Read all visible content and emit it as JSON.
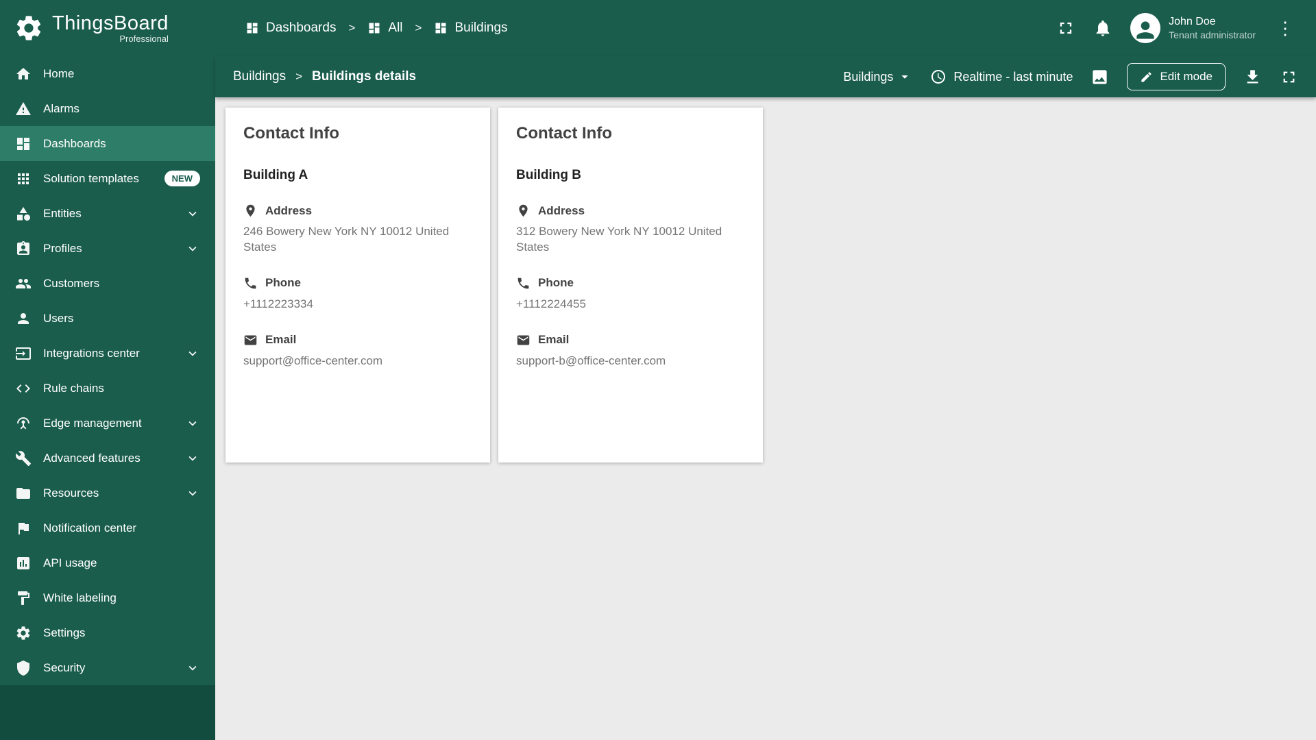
{
  "brand": {
    "name": "ThingsBoard",
    "subtitle": "Professional"
  },
  "topbar": {
    "separator": ">",
    "breadcrumbs": [
      {
        "label": "Dashboards",
        "icon": "dashboards"
      },
      {
        "label": "All",
        "icon": "dashboards"
      },
      {
        "label": "Buildings",
        "icon": "dashboards"
      }
    ],
    "user_name": "John Doe",
    "user_role": "Tenant administrator"
  },
  "toolbar": {
    "breadcrumb_root": "Buildings",
    "separator": ">",
    "breadcrumb_current": "Buildings details",
    "state_selector": "Buildings",
    "timewindow": "Realtime - last minute",
    "edit_mode_label": "Edit mode"
  },
  "sidebar": {
    "items": [
      {
        "label": "Home",
        "icon": "home"
      },
      {
        "label": "Alarms",
        "icon": "warning"
      },
      {
        "label": "Dashboards",
        "icon": "dashboards",
        "active": true
      },
      {
        "label": "Solution templates",
        "icon": "apps",
        "badge": "NEW"
      },
      {
        "label": "Entities",
        "icon": "category",
        "expandable": true
      },
      {
        "label": "Profiles",
        "icon": "badge",
        "expandable": true
      },
      {
        "label": "Customers",
        "icon": "people"
      },
      {
        "label": "Users",
        "icon": "person"
      },
      {
        "label": "Integrations center",
        "icon": "input",
        "expandable": true
      },
      {
        "label": "Rule chains",
        "icon": "code"
      },
      {
        "label": "Edge management",
        "icon": "antenna",
        "expandable": true
      },
      {
        "label": "Advanced features",
        "icon": "build",
        "expandable": true
      },
      {
        "label": "Resources",
        "icon": "folder",
        "expandable": true
      },
      {
        "label": "Notification center",
        "icon": "flag"
      },
      {
        "label": "API usage",
        "icon": "chart"
      },
      {
        "label": "White labeling",
        "icon": "paint"
      },
      {
        "label": "Settings",
        "icon": "settings"
      },
      {
        "label": "Security",
        "icon": "shield",
        "expandable": true
      }
    ]
  },
  "cards": [
    {
      "title": "Contact Info",
      "building": "Building A",
      "address_label": "Address",
      "address": "246 Bowery New York NY 10012 United States",
      "phone_label": "Phone",
      "phone": "+1112223334",
      "email_label": "Email",
      "email": "support@office-center.com"
    },
    {
      "title": "Contact Info",
      "building": "Building B",
      "address_label": "Address",
      "address": "312 Bowery New York NY 10012 United States",
      "phone_label": "Phone",
      "phone": "+1112224455",
      "email_label": "Email",
      "email": "support-b@office-center.com"
    }
  ],
  "colors": {
    "primary": "#1a5d4d",
    "active_item": "#2e7d68",
    "sidebar_footer": "#124c3e",
    "content_bg": "#ebebeb",
    "card_bg": "#ffffff"
  }
}
